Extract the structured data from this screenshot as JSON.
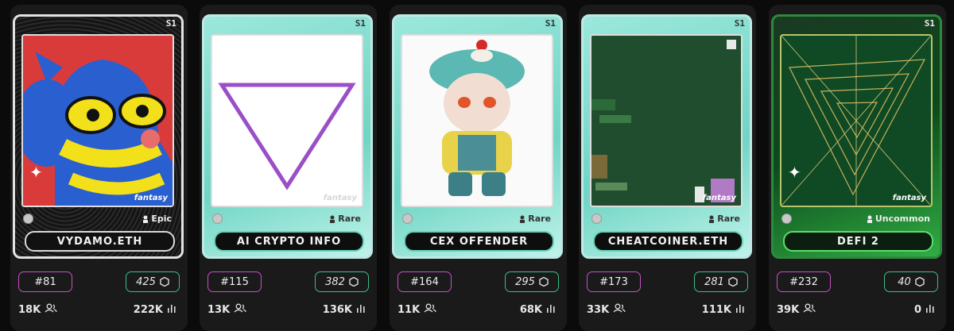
{
  "cards": [
    {
      "season": "S1",
      "rarity": "Epic",
      "name": "VYDAMO.ETH",
      "rank": "#81",
      "score": "425",
      "holders": "18K",
      "volume": "222K",
      "watermark": "fantasy"
    },
    {
      "season": "S1",
      "rarity": "Rare",
      "name": "AI CRYPTO INFO",
      "rank": "#115",
      "score": "382",
      "holders": "13K",
      "volume": "136K",
      "watermark": "fantasy"
    },
    {
      "season": "S1",
      "rarity": "Rare",
      "name": "CEX OFFENDER",
      "rank": "#164",
      "score": "295",
      "holders": "11K",
      "volume": "68K",
      "watermark": ""
    },
    {
      "season": "S1",
      "rarity": "Rare",
      "name": "CHEATCOINER.ETH",
      "rank": "#173",
      "score": "281",
      "holders": "33K",
      "volume": "111K",
      "watermark": "fantasy"
    },
    {
      "season": "S1",
      "rarity": "Uncommon",
      "name": "DEFI 2",
      "rank": "#232",
      "score": "40",
      "holders": "39K",
      "volume": "0",
      "watermark": "fantasy"
    }
  ],
  "colors": {
    "rank_border": "#c94fc8",
    "score_border": "#3bbf86",
    "rare_frame": "#9be8dc",
    "uncommon_frame": "#2fae43"
  },
  "icons": {
    "score": "hexagon-icon",
    "holders": "users-icon",
    "volume": "bar-chart-icon",
    "rarity": "person-icon"
  }
}
